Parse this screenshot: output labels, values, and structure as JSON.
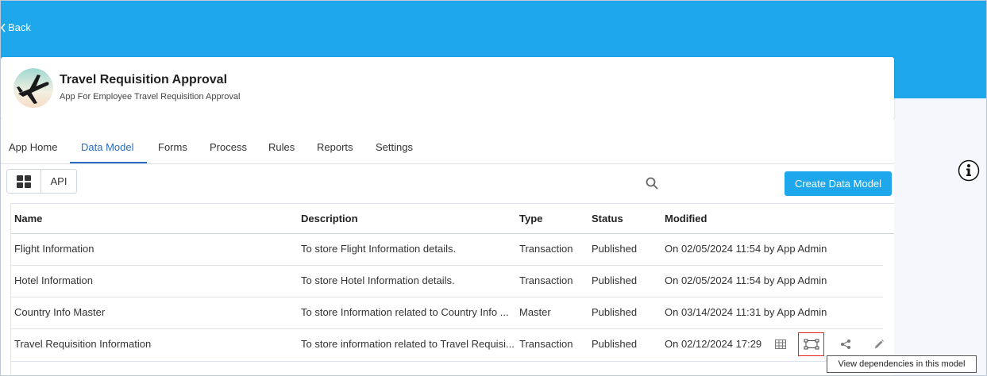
{
  "header": {
    "back_label": "Back"
  },
  "app": {
    "title": "Travel Requisition Approval",
    "subtitle": "App For Employee Travel Requisition Approval",
    "icon": "airplane-avatar-icon"
  },
  "tabs": [
    {
      "label": "App Home",
      "active": false
    },
    {
      "label": "Data Model",
      "active": true
    },
    {
      "label": "Forms",
      "active": false
    },
    {
      "label": "Process",
      "active": false
    },
    {
      "label": "Rules",
      "active": false
    },
    {
      "label": "Reports",
      "active": false
    },
    {
      "label": "Settings",
      "active": false
    }
  ],
  "toolbar": {
    "view_grid_icon": "grid-view-icon",
    "api_label": "API",
    "search_icon": "search-icon",
    "create_label": "Create Data Model"
  },
  "table": {
    "columns": [
      "Name",
      "Description",
      "Type",
      "Status",
      "Modified"
    ],
    "rows": [
      {
        "name": "Flight Information",
        "description": "To store Flight Information details.",
        "type": "Transaction",
        "status": "Published",
        "modified": "On 02/05/2024 11:54 by App Admin"
      },
      {
        "name": "Hotel Information",
        "description": "To store Hotel Information details.",
        "type": "Transaction",
        "status": "Published",
        "modified": "On 02/05/2024 11:54 by App Admin"
      },
      {
        "name": "Country Info Master",
        "description": "To store Information related to Country Info ...",
        "type": "Master",
        "status": "Published",
        "modified": "On 03/14/2024 11:31 by App Admin"
      },
      {
        "name": "Travel Requisition Information",
        "description": "To store information related to Travel Requisi...",
        "type": "Transaction",
        "status": "Published",
        "modified": "On 02/12/2024 17:29"
      }
    ]
  },
  "tooltip": "View dependencies in this model",
  "colors": {
    "header": "#1ea7eb",
    "accent": "#2a6cc4",
    "highlight": "#e02424"
  }
}
